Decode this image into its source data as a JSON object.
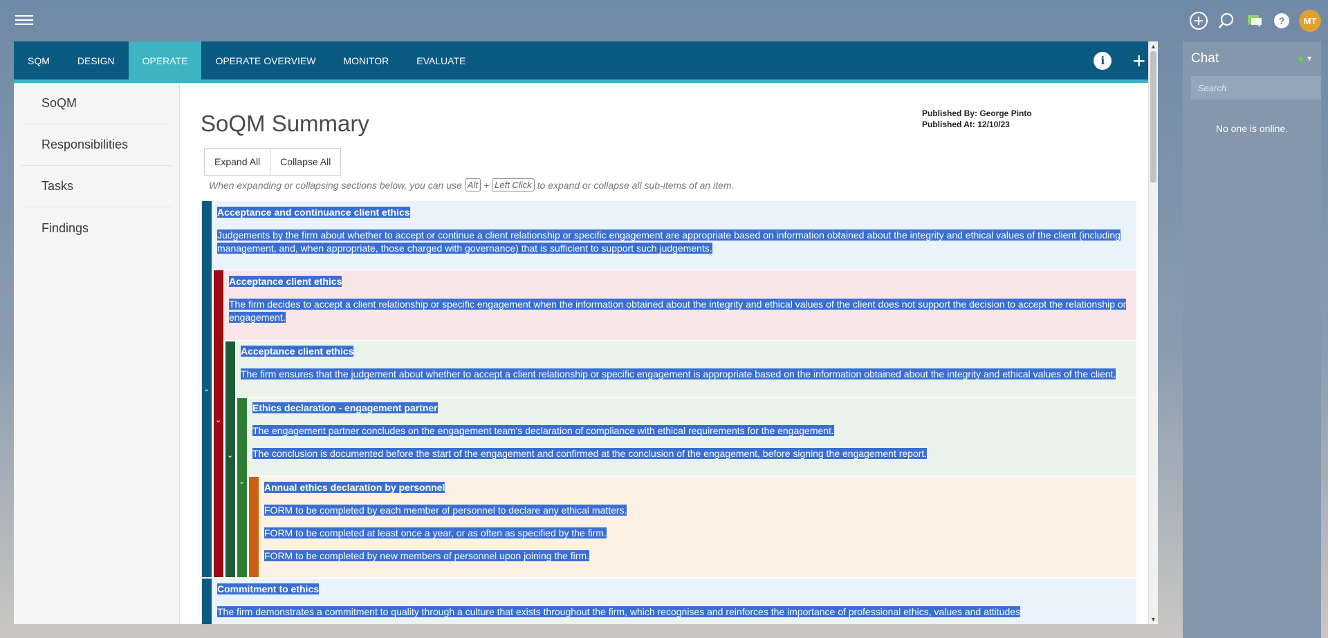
{
  "top_bar": {
    "avatar_initials": "MT",
    "icons": [
      "hamburger-menu-icon",
      "add-circle-icon",
      "search-icon",
      "chat-bubble-icon",
      "help-icon"
    ]
  },
  "nav": {
    "tabs": [
      {
        "label": "SQM",
        "active": false
      },
      {
        "label": "DESIGN",
        "active": false
      },
      {
        "label": "OPERATE",
        "active": true
      },
      {
        "label": "OPERATE OVERVIEW",
        "active": false
      },
      {
        "label": "MONITOR",
        "active": false
      },
      {
        "label": "EVALUATE",
        "active": false
      }
    ],
    "info_glyph": "i",
    "add_glyph": "+"
  },
  "sidebar": {
    "items": [
      {
        "label": "SoQM"
      },
      {
        "label": "Responsibilities"
      },
      {
        "label": "Tasks"
      },
      {
        "label": "Findings"
      }
    ]
  },
  "main": {
    "title": "SoQM Summary",
    "published_by": "Published By: George Pinto",
    "published_at": "Published At: 12/10/23",
    "expand_all": "Expand All",
    "collapse_all": "Collapse All",
    "hint_prefix": "When expanding or collapsing sections below, you can use",
    "hint_key1": "Alt",
    "hint_plus": "+",
    "hint_key2": "Left Click",
    "hint_suffix": "to expand or collapse all sub-items of an item."
  },
  "tree": {
    "n1": {
      "title": "Acceptance and continuance client ethics",
      "desc": "Judgements by the firm about whether to accept or continue a client relationship or specific engagement are appropriate based on information obtained about the integrity and ethical values of the client (including management, and, when appropriate, those charged with governance) that is sufficient to support such judgements."
    },
    "n2": {
      "title": "Acceptance client ethics",
      "desc": "The firm decides to accept a client relationship or specific engagement when the information obtained about the integrity and ethical values of the client does not support the decision to accept the relationship or engagement."
    },
    "n3": {
      "title": "Acceptance client ethics",
      "desc": "The firm ensures that the judgement about whether to accept a client relationship or specific engagement is appropriate based on the information obtained about the integrity and ethical values of the client."
    },
    "n4": {
      "title": "Ethics declaration - engagement partner",
      "desc1": "The engagement partner concludes on the engagement team's declaration of compliance with ethical requirements for the engagement.",
      "desc2": "The conclusion is documented before the start of the engagement and confirmed at the conclusion of the engagement, before signing the engagement report."
    },
    "n5": {
      "title": "Annual ethics declaration by personnel",
      "items": [
        "FORM to be completed by each member of personnel to declare any ethical matters.",
        "FORM to be completed at least once a year, or as often as specified by the firm.",
        "FORM to be completed by new members of personnel upon joining the firm."
      ]
    },
    "n6": {
      "title": "Commitment to ethics",
      "desc": "The firm demonstrates a commitment to quality through a culture that exists throughout the firm, which recognises and reinforces the importance of professional ethics, values and attitudes"
    },
    "colors": {
      "level1": "#0a5a82",
      "level2": "#9b0c12",
      "level3": "#1d5c38",
      "level4": "#2e7d32",
      "level5": "#c9620e",
      "highlight": "#3a6fd1"
    }
  },
  "chat": {
    "title": "Chat",
    "search_placeholder": "Search",
    "empty_message": "No one is online."
  }
}
